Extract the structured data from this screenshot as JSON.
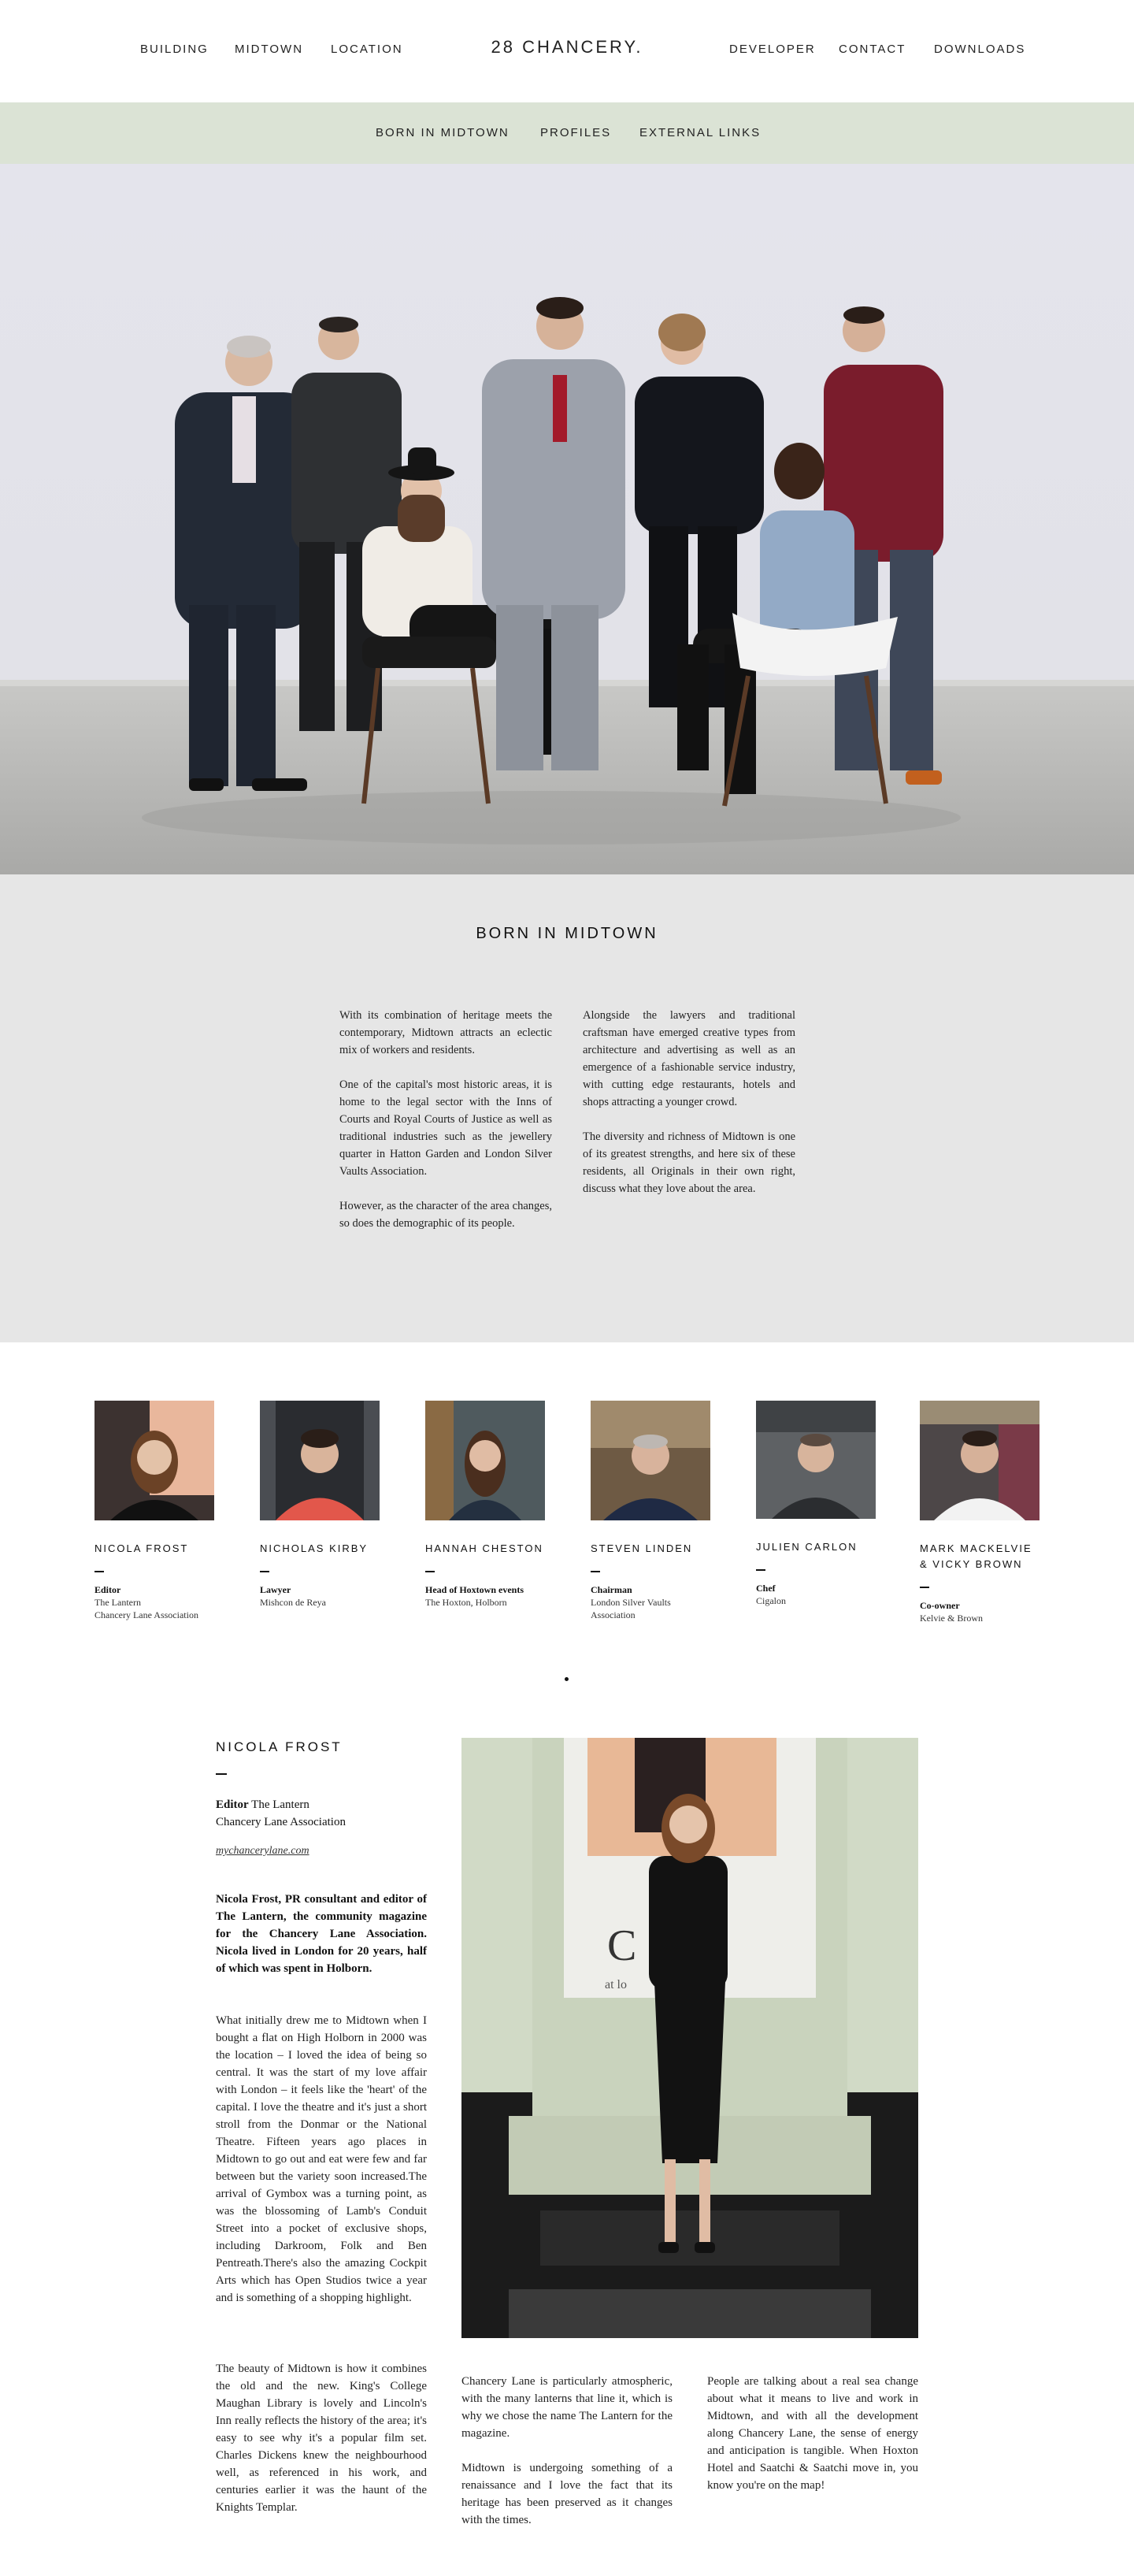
{
  "header": {
    "nav_left": [
      "BUILDING",
      "MIDTOWN",
      "LOCATION"
    ],
    "logo": "28 CHANCERY.",
    "nav_right": [
      "DEVELOPER",
      "CONTACT",
      "DOWNLOADS"
    ]
  },
  "subnav": [
    "BORN IN MIDTOWN",
    "PROFILES",
    "EXTERNAL LINKS"
  ],
  "intro": {
    "title": "BORN IN MIDTOWN",
    "left": [
      "With its combination of heritage meets the contemporary, Midtown attracts an eclectic mix of workers and residents.",
      "One of the capital's most historic areas, it is home to the legal sector with the Inns of Courts and Royal Courts of Justice as well as traditional industries such as the jewellery quarter in Hatton Garden and London Silver Vaults Association.",
      "However, as the character of the area changes, so does the demographic of its people."
    ],
    "right": [
      "Alongside the lawyers and traditional craftsman have emerged creative types from architecture and advertising as well as an emergence of a fashionable service industry, with cutting edge restaurants, hotels and shops attracting a younger crowd.",
      "The diversity and richness of Midtown is one of its greatest strengths, and here six of these residents, all Originals in their own right, discuss what they love about the area."
    ]
  },
  "profiles": [
    {
      "name": "NICOLA FROST",
      "role": "Editor",
      "org": "The Lantern",
      "org2": "Chancery Lane Association"
    },
    {
      "name": "NICHOLAS KIRBY",
      "role": "Lawyer",
      "org": "Mishcon de Reya",
      "org2": ""
    },
    {
      "name": "HANNAH CHESTON",
      "role": "Head of Hoxtown events",
      "org": "The Hoxton, Holborn",
      "org2": ""
    },
    {
      "name": "STEVEN LINDEN",
      "role": "Chairman",
      "org": "London Silver Vaults",
      "org2": "Association"
    },
    {
      "name": "JULIEN CARLON",
      "role": "Chef",
      "org": "Cigalon",
      "org2": ""
    },
    {
      "name": "MARK MACKELVIE",
      "name2": "& VICKY BROWN",
      "role": "Co-owner",
      "org": "Kelvie & Brown",
      "org2": ""
    }
  ],
  "detail": {
    "name": "NICOLA FROST",
    "role_label": "Editor",
    "role_org": "The Lantern",
    "role_org2": "Chancery Lane Association",
    "link": "mychancerylane.com",
    "lead": "Nicola Frost, PR consultant and editor of The Lantern, the community magazine for the Chancery Lane Association. Nicola lived in London for 20 years, half of which was spent in Holborn.",
    "body1": "What initially drew me to Midtown when I bought a flat on High Holborn in 2000 was the location – I loved the idea of being so central. It was the start of my love affair with London – it feels like the 'heart' of the capital. I love the theatre and it's just a short stroll from the Donmar or the National Theatre. Fifteen years ago places in Midtown to go out and eat were few and far between but the variety soon increased.The arrival of Gymbox was a turning point, as was the blossoming of Lamb's Conduit Street into a pocket of exclusive shops, including Darkroom, Folk and Ben Pentreath.There's also the amazing Cockpit Arts which has Open Studios twice a year and is something of a shopping highlight.",
    "body2": "The beauty of Midtown is how it combines the old and the new. King's College Maughan Library is lovely and Lincoln's Inn really reflects the history of the area; it's easy to see why it's a popular film set. Charles Dickens knew the neighbourhood well, as referenced in his work, and centuries earlier it was the haunt of the Knights Templar.",
    "col2": [
      "Chancery Lane is particularly atmospheric, with the many lanterns that line it, which is why we chose the name The Lantern for the magazine.",
      "Midtown is undergoing something of a renaissance and I love the fact that its heritage has been preserved as it changes with the times."
    ],
    "col3": [
      "People are talking about a real sea change about what it means to live and work in Midtown, and with all the development along Chancery Lane, the sense of energy and anticipation is tangible. When Hoxton Hotel and Saatchi & Saatchi move in, you know you're on the map!"
    ],
    "poster_text": "C",
    "poster_sub": "at lo"
  },
  "colors": {
    "subnav_bg": "#dbe3d5",
    "intro_bg": "#e6e6e6",
    "hero_bg": "#e4e4ec",
    "floor": "#b9b9b7"
  }
}
